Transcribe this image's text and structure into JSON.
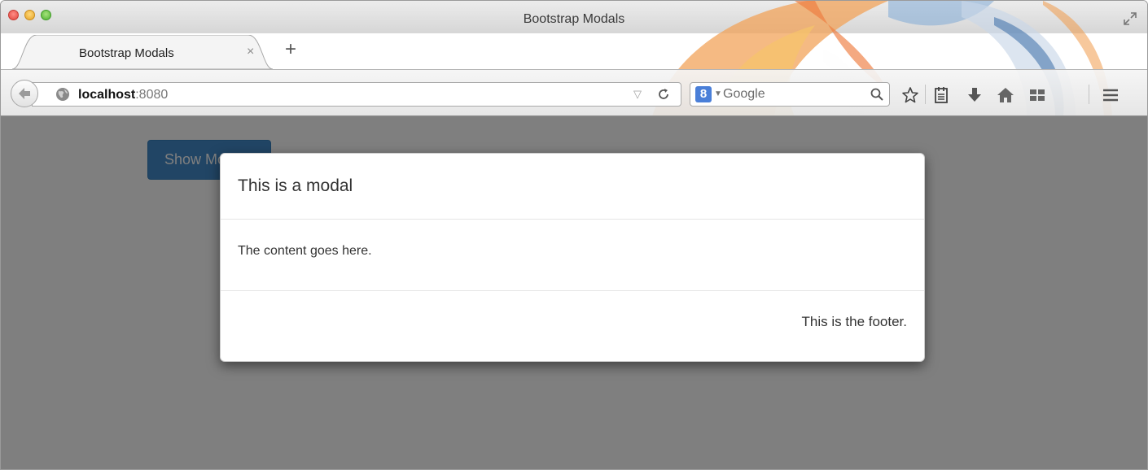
{
  "window": {
    "title": "Bootstrap Modals"
  },
  "tabs": [
    {
      "label": "Bootstrap Modals",
      "active": true
    }
  ],
  "new_tab": {
    "label": "+"
  },
  "tab_close": {
    "label": "×"
  },
  "url": {
    "host": "localhost",
    "port": ":8080"
  },
  "search": {
    "engine_badge": "8",
    "placeholder": "Google"
  },
  "toolbar_icons": [
    "bookmark-star-icon",
    "reading-list-icon",
    "downloads-icon",
    "home-icon",
    "tiles-icon",
    "menu-icon"
  ],
  "page": {
    "button_label": "Show Modal",
    "modal": {
      "title": "This is a modal",
      "body": "The content goes here.",
      "footer": "This is the footer."
    }
  },
  "colors": {
    "primary_button": "#428bca",
    "backdrop": "rgba(0,0,0,0.5)"
  }
}
